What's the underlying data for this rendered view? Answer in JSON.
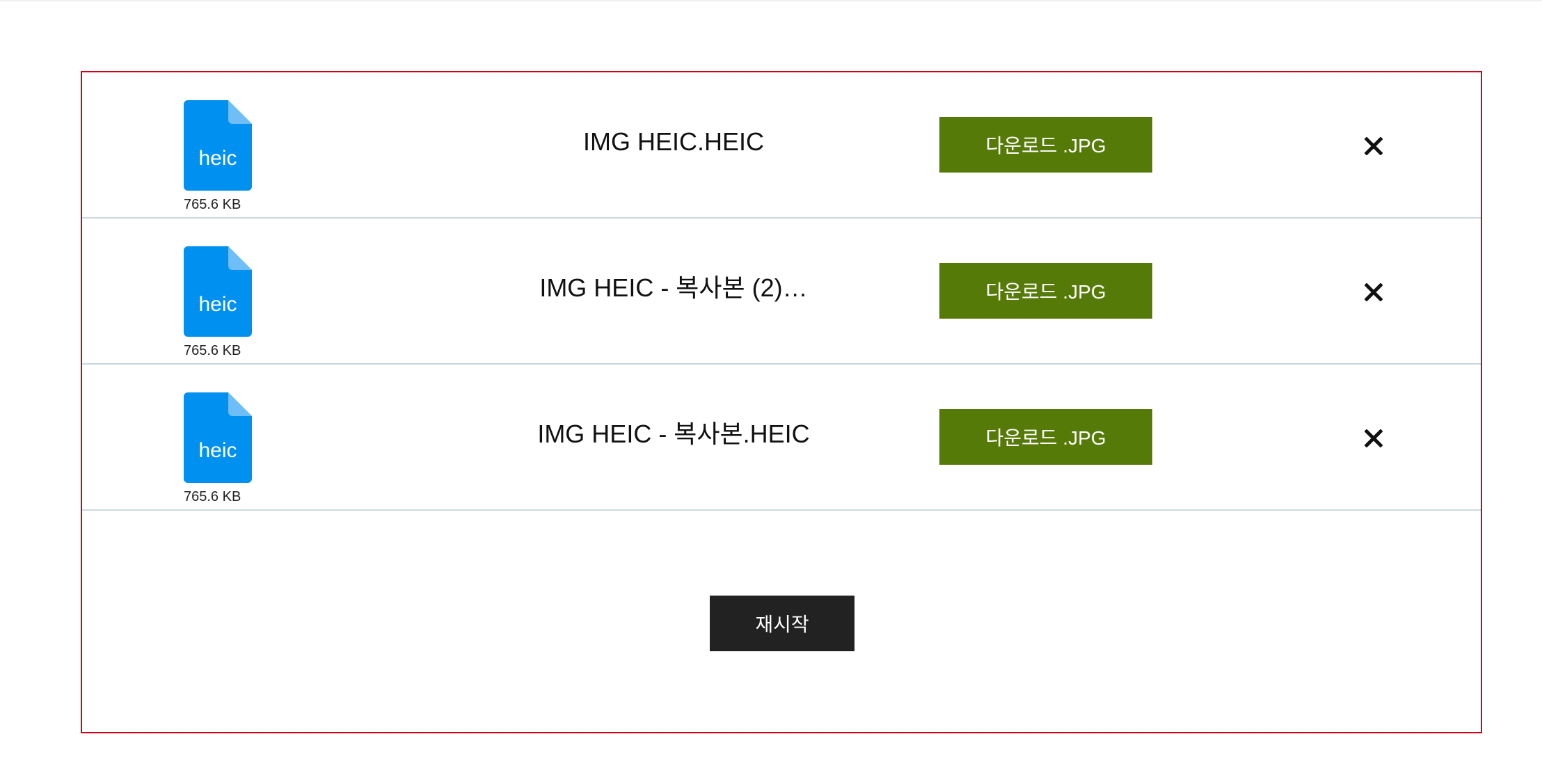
{
  "files": [
    {
      "icon": "heic-file-icon",
      "ext_label": "heic",
      "size": "765.6 KB",
      "name": "IMG HEIC.HEIC",
      "download_label": "다운로드 .JPG",
      "remove_icon": "close-icon"
    },
    {
      "icon": "heic-file-icon",
      "ext_label": "heic",
      "size": "765.6 KB",
      "name": "IMG HEIC - 복사본 (2)…",
      "download_label": "다운로드 .JPG",
      "remove_icon": "close-icon"
    },
    {
      "icon": "heic-file-icon",
      "ext_label": "heic",
      "size": "765.6 KB",
      "name": "IMG HEIC - 복사본.HEIC",
      "download_label": "다운로드 .JPG",
      "remove_icon": "close-icon"
    }
  ],
  "restart_label": "재시작",
  "colors": {
    "panel_border": "#d0021b",
    "file_icon": "#0091f0",
    "file_icon_fold": "#6fbef7",
    "download_button": "#567a08",
    "restart_button": "#222222",
    "row_divider": "#c9d7e0"
  }
}
